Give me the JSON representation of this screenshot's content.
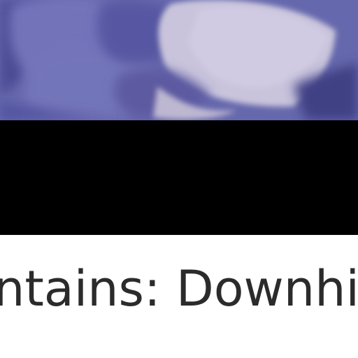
{
  "video_card": {
    "thumbnail": {
      "description_icon": "video-thumbnail",
      "colors": {
        "base": "#6f6fb4",
        "shadow": "#3d3d86",
        "highlight": "#c8c3da"
      }
    },
    "title": "ntains: Downhil"
  }
}
